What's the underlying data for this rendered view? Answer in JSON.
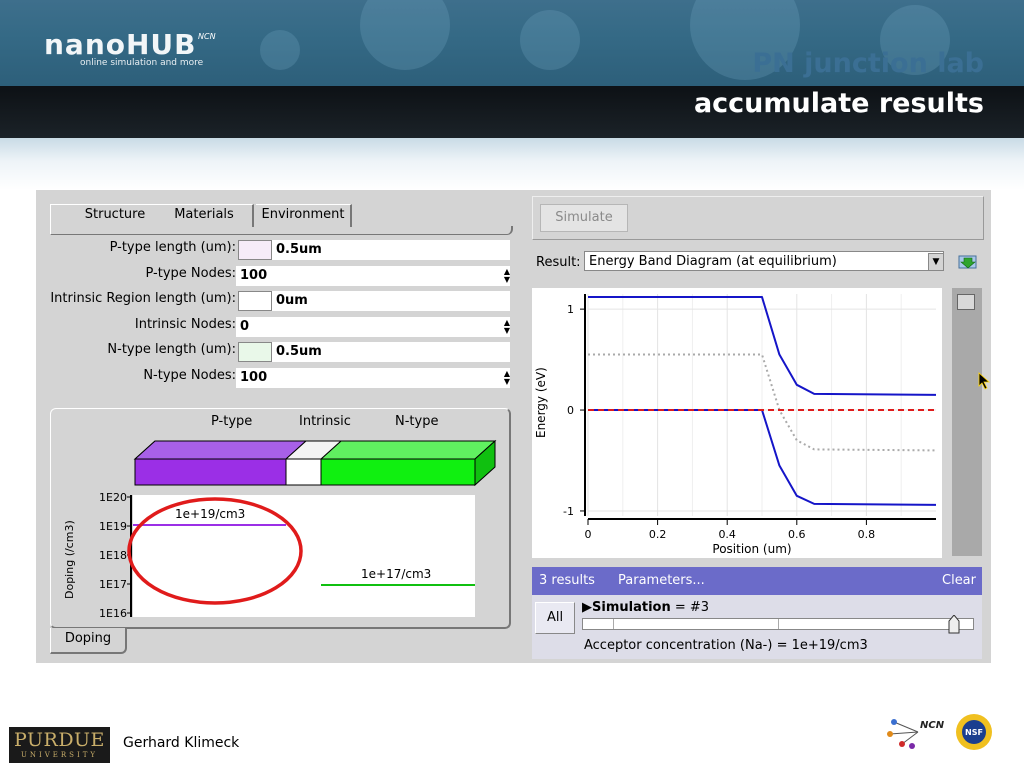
{
  "header": {
    "logo_name": "nanoHUB",
    "logo_tagline": "online simulation and more",
    "ncn_small": "NCN",
    "title_line1": "PN junction lab",
    "title_line2": "accumulate results"
  },
  "tabs": [
    {
      "label": "Structure"
    },
    {
      "label": "Materials"
    },
    {
      "label": "Environment"
    }
  ],
  "fields": [
    {
      "label": "P-type length (um):",
      "value": "0.5um"
    },
    {
      "label": "P-type Nodes:",
      "value": "100"
    },
    {
      "label": "Intrinsic Region length (um):",
      "value": "0um"
    },
    {
      "label": "Intrinsic Nodes:",
      "value": "0"
    },
    {
      "label": "N-type length (um):",
      "value": "0.5um"
    },
    {
      "label": "N-type Nodes:",
      "value": "100"
    }
  ],
  "structure": {
    "labels": [
      "P-type",
      "Intrinsic",
      "N-type"
    ],
    "colors": {
      "p": "#9b2fe6",
      "i": "#ffffff",
      "n": "#10f010"
    },
    "doping_ylabel": "Doping (/cm3)",
    "doping_ticks": [
      "1E20",
      "1E19",
      "1E18",
      "1E17",
      "1E16"
    ],
    "p_doping_label": "1e+19/cm3",
    "n_doping_label": "1e+17/cm3",
    "tab_label": "Doping",
    "highlight_color": "#e01b1b"
  },
  "simulate_label": "Simulate",
  "result": {
    "label": "Result:",
    "selected": "Energy Band Diagram (at equilibrium)"
  },
  "chart_data": {
    "type": "line",
    "title": "",
    "xlabel": "Position (um)",
    "ylabel": "Energy (eV)",
    "xlim": [
      0,
      1
    ],
    "ylim": [
      -1.05,
      1.15
    ],
    "xticks": [
      "0",
      "0.2",
      "0.4",
      "0.6",
      "0.8"
    ],
    "yticks": [
      "1",
      "0",
      "-1"
    ],
    "grid": true,
    "series": [
      {
        "color": "#1515c8",
        "style": "solid",
        "x": [
          0,
          0.5,
          0.55,
          0.6,
          0.65,
          1.0
        ],
        "y": [
          1.12,
          1.12,
          0.55,
          0.25,
          0.16,
          0.15
        ]
      },
      {
        "color": "#1515c8",
        "style": "solid",
        "x": [
          0,
          0.5,
          0.55,
          0.6,
          0.65,
          1.0
        ],
        "y": [
          0.0,
          0.0,
          -0.55,
          -0.85,
          -0.93,
          -0.94
        ]
      },
      {
        "color": "#aaaaaa",
        "style": "dotted",
        "x": [
          0,
          0.5,
          0.55,
          0.6,
          0.65,
          1.0
        ],
        "y": [
          0.55,
          0.55,
          0.0,
          -0.3,
          -0.39,
          -0.4
        ]
      },
      {
        "color": "#e01b1b",
        "style": "dashed",
        "x": [
          0,
          1.0
        ],
        "y": [
          0.0,
          0.0
        ]
      }
    ]
  },
  "results_bar": {
    "count": "3 results",
    "parameters": "Parameters...",
    "clear": "Clear"
  },
  "simulation": {
    "all_label": "All",
    "name": "Simulation",
    "value": "= #3",
    "slider_fraction": 0.95,
    "acceptor_text": "Acceptor concentration (Na-) = 1e+19/cm3"
  },
  "footer": {
    "purdue": "PURDUE",
    "purdue_sub": "UNIVERSITY",
    "author": "Gerhard Klimeck",
    "ncn_logo": "NCN",
    "nsf_logo": "NSF"
  }
}
